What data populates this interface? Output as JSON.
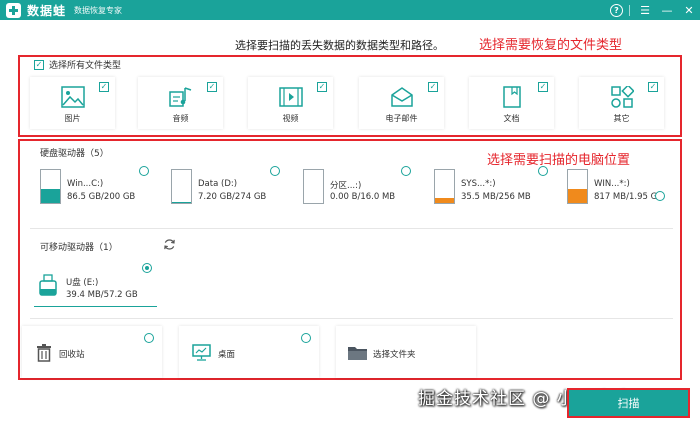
{
  "app": {
    "name": "数据蛙",
    "subtitle": "数据恢复专家",
    "help_label": "?",
    "menu_label": "☰",
    "minimize_label": "—",
    "close_label": "✕"
  },
  "instruction": "选择要扫描的丢失数据的数据类型和路径。",
  "annotations": {
    "file_type": "选择需要恢复的文件类型",
    "location": "选择需要扫描的电脑位置"
  },
  "file_types": {
    "select_all_label": "选择所有文件类型",
    "select_all_checked": true,
    "items": [
      {
        "label": "图片",
        "icon": "image-icon",
        "checked": true
      },
      {
        "label": "音频",
        "icon": "music-icon",
        "checked": true
      },
      {
        "label": "视频",
        "icon": "video-icon",
        "checked": true
      },
      {
        "label": "电子邮件",
        "icon": "email-icon",
        "checked": true
      },
      {
        "label": "文档",
        "icon": "document-icon",
        "checked": true
      },
      {
        "label": "其它",
        "icon": "other-icon",
        "checked": true
      }
    ]
  },
  "hard_drives": {
    "title": "硬盘驱动器（5）",
    "items": [
      {
        "name": "Win...C:)",
        "size": "86.5 GB/200 GB",
        "used": 0.43,
        "color": "#1aa39a"
      },
      {
        "name": "Data (D:)",
        "size": "7.20 GB/274 GB",
        "used": 0.03,
        "color": "#1aa39a"
      },
      {
        "name": "分区...:)",
        "size": "0.00  B/16.0 MB",
        "used": 0.0,
        "color": "#1aa39a"
      },
      {
        "name": "SYS...*:)",
        "size": "35.5 MB/256 MB",
        "used": 0.14,
        "color": "#f08a1c"
      },
      {
        "name": "WIN...*:)",
        "size": "817 MB/1.95 GB",
        "used": 0.42,
        "color": "#f08a1c"
      }
    ]
  },
  "removable_drives": {
    "title": "可移动驱动器（1）",
    "items": [
      {
        "name": "U盘 (E:)",
        "size": "39.4 MB/57.2 GB",
        "selected": true
      }
    ]
  },
  "locations": [
    {
      "label": "回收站",
      "icon": "recycle-bin-icon"
    },
    {
      "label": "桌面",
      "icon": "desktop-icon"
    },
    {
      "label": "选择文件夹",
      "icon": "folder-icon"
    }
  ],
  "scan_button": "扫描",
  "watermark": "掘金技术社区 @ 小明助手",
  "colors": {
    "accent": "#1aa39a",
    "annotation": "#e5252c",
    "warning": "#f08a1c"
  }
}
